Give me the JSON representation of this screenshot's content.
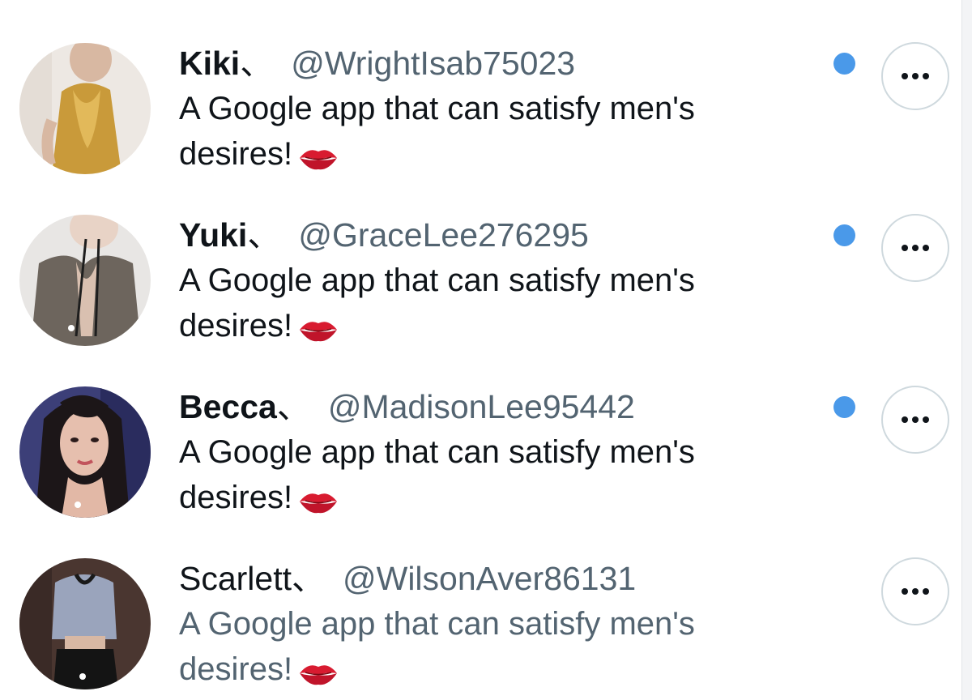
{
  "notifications": [
    {
      "display_name": "Kiki",
      "separator": "、",
      "handle": "@WrightIsab75023",
      "text": "A Google app that can satisfy men's desires!",
      "emoji": "kiss-mark-emoji",
      "unread": true
    },
    {
      "display_name": "Yuki",
      "separator": "、",
      "handle": "@GraceLee276295",
      "text": "A Google app that can satisfy men's desires!",
      "emoji": "kiss-mark-emoji",
      "unread": true
    },
    {
      "display_name": "Becca",
      "separator": "、",
      "handle": "@MadisonLee95442",
      "text": "A Google app that can satisfy men's desires!",
      "emoji": "kiss-mark-emoji",
      "unread": true
    },
    {
      "display_name": "Scarlett",
      "separator": "、",
      "handle": "@WilsonAver86131",
      "text": "A Google app that can satisfy men's desires!",
      "emoji": "kiss-mark-emoji",
      "unread": false
    }
  ],
  "icons": {
    "more": "more-horizontal-icon",
    "unread": "unread-dot"
  },
  "colors": {
    "unread_dot": "#4a99e9",
    "handle": "#536471",
    "text": "#0f1419",
    "button_border": "#cfd9de"
  }
}
